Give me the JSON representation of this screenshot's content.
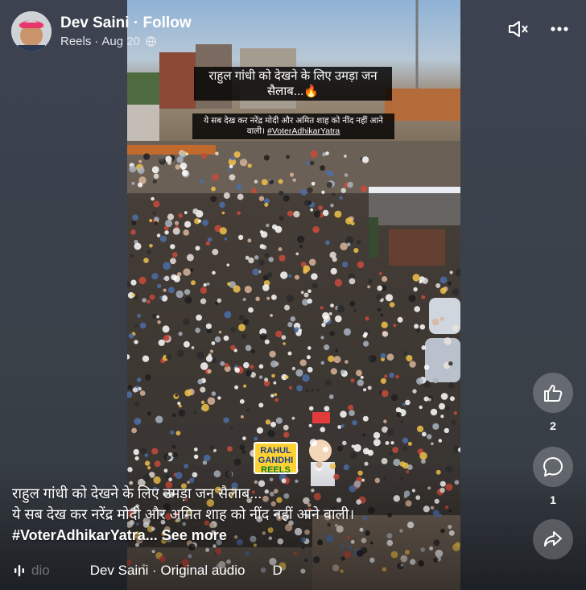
{
  "header": {
    "author": "Dev Saini",
    "separator": " · ",
    "follow_label": "Follow",
    "section": "Reels",
    "dot": " · ",
    "date": "Aug 20",
    "privacy_icon": "globe-icon"
  },
  "top_controls": {
    "mute_icon": "speaker-muted-icon",
    "more_icon": "more-options-icon"
  },
  "video_overlay": {
    "title_line": "राहुल गांधी को देखने के लिए उमड़ा जन सैलाब...🔥",
    "subtitle_text": "ये सब देख कर नरेंद्र मोदी और अमित शाह को नींद नहीं आने वाली। ",
    "subtitle_hashtag": "#VoterAdhikarYatra",
    "badge_line1": "RAHUL",
    "badge_line2": "GANDHI",
    "badge_line3": "REELS"
  },
  "actions": {
    "like_icon": "thumbs-up-icon",
    "like_count": "2",
    "comment_icon": "comment-icon",
    "comment_count": "1",
    "share_icon": "share-arrow-icon"
  },
  "caption": {
    "line1": "राहुल गांधी को देखने के लिए उमड़ा जन सैलाब...",
    "line2": "ये सब देख कर नरेंद्र मोदी और अमित शाह को नींद नहीं आने वाली।",
    "hashtag": "#VoterAdhikarYatra",
    "ellipsis": "...",
    "see_more": "See more"
  },
  "audio": {
    "icon": "audio-wave-icon",
    "faded_text": "dio",
    "track": "Dev Saini · Original audio",
    "trailing": "D"
  },
  "colors": {
    "background": "#3a4049",
    "badge_yellow": "#ffd233",
    "badge_blue": "#1d3f8a"
  }
}
